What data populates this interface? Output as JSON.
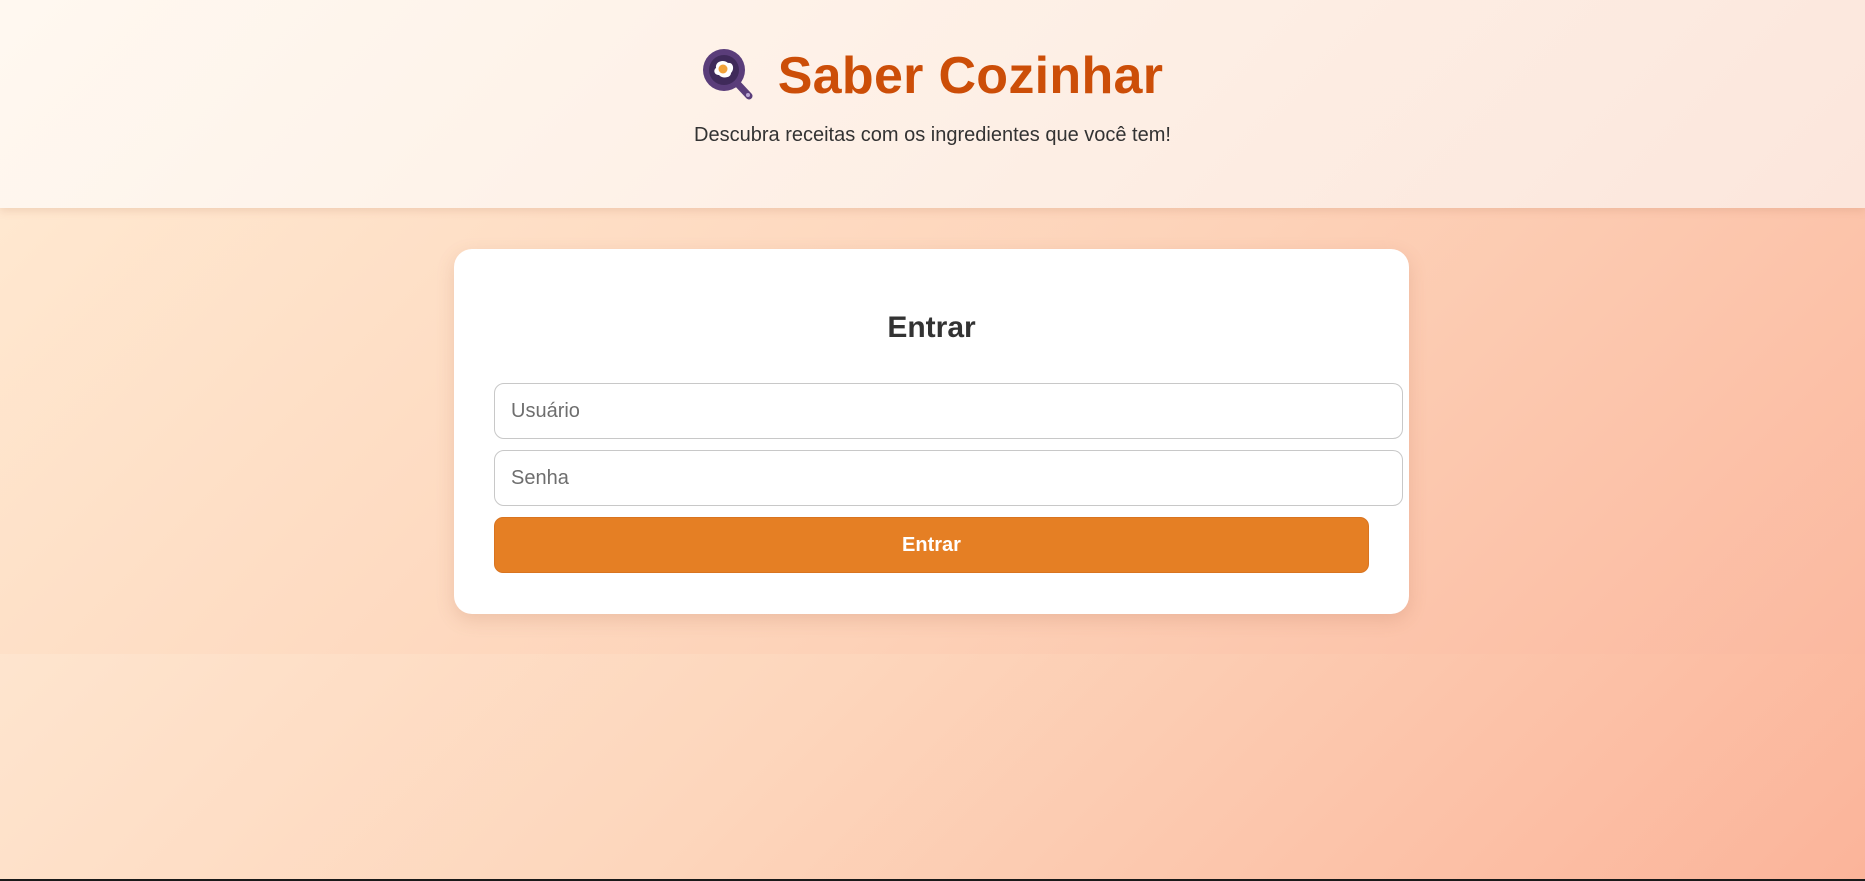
{
  "header": {
    "logo_icon": "frying-pan-egg-magnifier-icon",
    "title": "Saber Cozinhar",
    "tagline": "Descubra receitas com os ingredientes que você tem!"
  },
  "login": {
    "heading": "Entrar",
    "username_placeholder": "Usuário",
    "username_value": "",
    "password_placeholder": "Senha",
    "password_value": "",
    "submit_label": "Entrar"
  },
  "colors": {
    "brand": "#cc4e08",
    "button": "#e57f24",
    "logo": "#5a3d7a"
  }
}
